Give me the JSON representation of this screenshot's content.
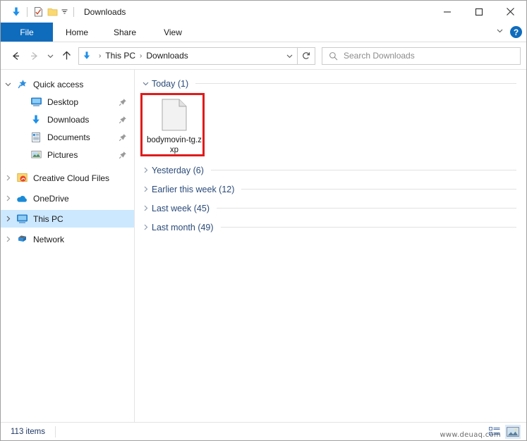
{
  "window": {
    "title": "Downloads",
    "quick_access_icons": [
      "download-arrow-icon",
      "properties-checkmark-icon",
      "folder-icon",
      "customize-chevron-icon"
    ],
    "controls": {
      "minimize": "—",
      "maximize": "□",
      "close": "✕"
    }
  },
  "ribbon": {
    "tabs": [
      {
        "label": "File",
        "active": true
      },
      {
        "label": "Home",
        "active": false
      },
      {
        "label": "Share",
        "active": false
      },
      {
        "label": "View",
        "active": false
      }
    ],
    "collapse_icon": "chevron-down-icon",
    "help_label": "?"
  },
  "addressbar": {
    "back_icon": "back-arrow-icon",
    "forward_icon": "forward-arrow-icon",
    "recent_icon": "chevron-down-icon",
    "up_icon": "up-arrow-icon",
    "path_icon": "download-arrow-icon",
    "breadcrumbs": [
      "This PC",
      "Downloads"
    ],
    "separator": "›",
    "dropdown_icon": "chevron-down-icon",
    "refresh_icon": "refresh-icon"
  },
  "search": {
    "icon": "search-icon",
    "placeholder": "Search Downloads",
    "value": ""
  },
  "sidebar": {
    "items": [
      {
        "label": "Quick access",
        "icon": "star-pin-icon",
        "expander": "chevron-down-icon",
        "indent": 0,
        "pinned": false,
        "selected": false
      },
      {
        "label": "Desktop",
        "icon": "desktop-monitor-icon",
        "expander": "",
        "indent": 1,
        "pinned": true,
        "selected": false
      },
      {
        "label": "Downloads",
        "icon": "download-arrow-icon",
        "expander": "",
        "indent": 1,
        "pinned": true,
        "selected": false
      },
      {
        "label": "Documents",
        "icon": "documents-icon",
        "expander": "",
        "indent": 1,
        "pinned": true,
        "selected": false
      },
      {
        "label": "Pictures",
        "icon": "pictures-icon",
        "expander": "",
        "indent": 1,
        "pinned": true,
        "selected": false
      },
      {
        "label": "Creative Cloud Files",
        "icon": "creative-cloud-icon",
        "expander": "chevron-right-icon",
        "indent": 0,
        "pinned": false,
        "selected": false
      },
      {
        "label": "OneDrive",
        "icon": "onedrive-cloud-icon",
        "expander": "chevron-right-icon",
        "indent": 0,
        "pinned": false,
        "selected": false
      },
      {
        "label": "This PC",
        "icon": "this-pc-icon",
        "expander": "chevron-right-icon",
        "indent": 0,
        "pinned": false,
        "selected": true
      },
      {
        "label": "Network",
        "icon": "network-icon",
        "expander": "chevron-right-icon",
        "indent": 0,
        "pinned": false,
        "selected": false
      }
    ]
  },
  "filelist": {
    "groups": [
      {
        "label": "Today (1)",
        "expanded": true,
        "expander": "chevron-down-icon"
      },
      {
        "label": "Yesterday (6)",
        "expanded": false,
        "expander": "chevron-right-icon"
      },
      {
        "label": "Earlier this week (12)",
        "expanded": false,
        "expander": "chevron-right-icon"
      },
      {
        "label": "Last week (45)",
        "expanded": false,
        "expander": "chevron-right-icon"
      },
      {
        "label": "Last month (49)",
        "expanded": false,
        "expander": "chevron-right-icon"
      }
    ],
    "files": [
      {
        "name": "bodymovin-tg.zxp",
        "icon": "generic-document-icon",
        "highlighted": true
      }
    ]
  },
  "annotation": {
    "shape": "rectangle",
    "color": "#e01b1b",
    "target": "bodymovin-tg.zxp"
  },
  "statusbar": {
    "item_count": "113 items",
    "view_buttons": [
      {
        "name": "details-view-button",
        "active": false
      },
      {
        "name": "large-icons-view-button",
        "active": true
      }
    ],
    "watermark": "www.deuaq.com"
  },
  "colors": {
    "accent_blue": "#0f6cbd",
    "selection_blue": "#cce8ff",
    "group_header_text": "#2b4b79",
    "annotation_red": "#e01b1b",
    "status_text": "#1f3864"
  }
}
